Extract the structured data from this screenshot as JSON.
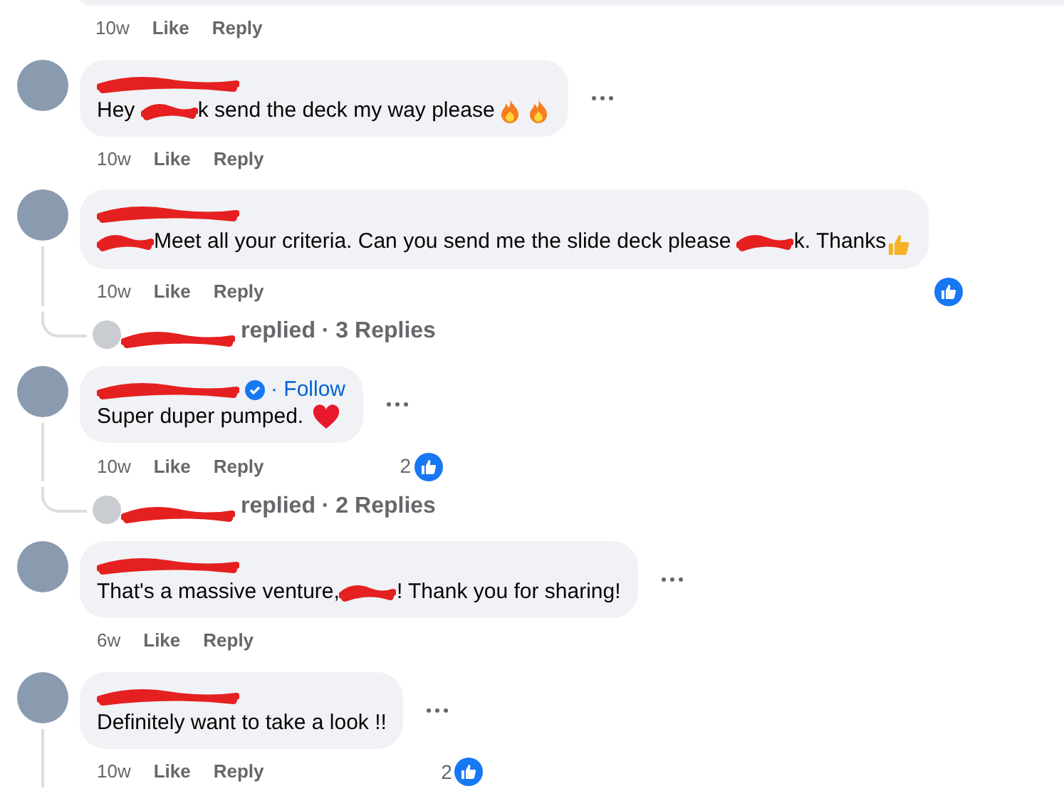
{
  "comments": [
    {
      "kind": "clipped",
      "time": "10w",
      "like": "Like",
      "reply": "Reply"
    },
    {
      "kind": "full",
      "name_redacted": true,
      "parts": [
        {
          "kind": "text",
          "text": "Hey "
        },
        {
          "kind": "redacted"
        },
        {
          "kind": "text",
          "text": "k send the deck my way please"
        },
        {
          "kind": "fire"
        },
        {
          "kind": "fire"
        }
      ],
      "menu": true,
      "time": "10w",
      "like": "Like",
      "reply": "Reply"
    },
    {
      "kind": "full",
      "name_redacted": true,
      "parts": [
        {
          "kind": "redacted"
        },
        {
          "kind": "text",
          "text": "Meet all your criteria. Can you send me the slide deck please "
        },
        {
          "kind": "redacted"
        },
        {
          "kind": "text",
          "text": "k. Thanks"
        },
        {
          "kind": "thumbs-up"
        }
      ],
      "time": "10w",
      "like": "Like",
      "reply": "Reply",
      "reaction": {
        "kind": "like"
      },
      "thread": true
    },
    {
      "kind": "replies",
      "text": "replied · 3 Replies"
    },
    {
      "kind": "full",
      "name_redacted": true,
      "verified": true,
      "follow": "· Follow",
      "parts": [
        {
          "kind": "text",
          "text": "Super duper pumped."
        },
        {
          "kind": "heart"
        }
      ],
      "menu": true,
      "time": "10w",
      "like": "Like",
      "reply": "Reply",
      "reaction": {
        "kind": "like",
        "count": "2"
      },
      "thread": true
    },
    {
      "kind": "replies",
      "text": "replied · 2 Replies"
    },
    {
      "kind": "full",
      "name_redacted": true,
      "parts": [
        {
          "kind": "text",
          "text": "That's a massive venture,"
        },
        {
          "kind": "redacted"
        },
        {
          "kind": "text",
          "text": "! Thank you for sharing!"
        }
      ],
      "menu": true,
      "time": "6w",
      "like": "Like",
      "reply": "Reply"
    },
    {
      "kind": "full",
      "name_redacted": true,
      "parts": [
        {
          "kind": "text",
          "text": "Definitely want to take a look !!"
        }
      ],
      "menu": true,
      "time": "10w",
      "like": "Like",
      "reply": "Reply",
      "reaction": {
        "kind": "like",
        "count": "2"
      },
      "thread": true
    }
  ]
}
